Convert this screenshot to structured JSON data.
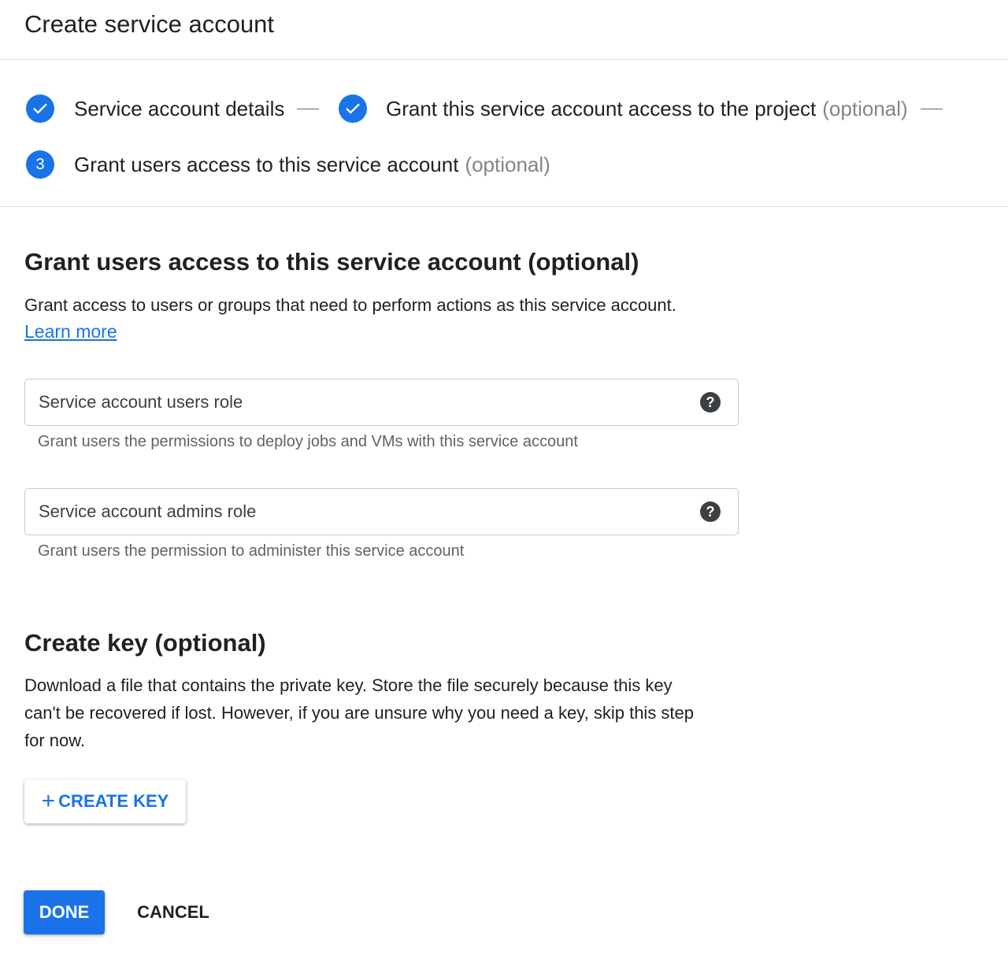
{
  "header": {
    "title": "Create service account"
  },
  "stepper": {
    "steps": [
      {
        "label": "Service account details",
        "optional": "",
        "state": "complete",
        "icon": "check-icon"
      },
      {
        "label": "Grant this service account access to the project",
        "optional": "(optional)",
        "state": "complete",
        "icon": "check-icon"
      },
      {
        "label": "Grant users access to this service account",
        "optional": "(optional)",
        "state": "current",
        "number": "3"
      }
    ]
  },
  "grant_section": {
    "title": "Grant users access to this service account (optional)",
    "description": "Grant access to users or groups that need to perform actions as this service account.",
    "learn_more": "Learn more",
    "fields": [
      {
        "label": "Service account users role",
        "hint": "Grant users the permissions to deploy jobs and VMs with this service account",
        "help_icon": "help-icon"
      },
      {
        "label": "Service account admins role",
        "hint": "Grant users the permission to administer this service account",
        "help_icon": "help-icon"
      }
    ]
  },
  "key_section": {
    "title": "Create key (optional)",
    "description_lines": [
      "Download a file that contains the private key. Store the file securely because this key",
      "can't be recovered if lost. However, if you are unsure why you need a key, skip this step",
      "for now."
    ],
    "create_key_label": "CREATE KEY",
    "create_key_icon": "plus-icon"
  },
  "actions": {
    "done_label": "DONE",
    "cancel_label": "CANCEL"
  },
  "colors": {
    "accent": "#1a73e8",
    "text": "#202124",
    "muted": "#80868b",
    "divider": "#dadce0"
  }
}
